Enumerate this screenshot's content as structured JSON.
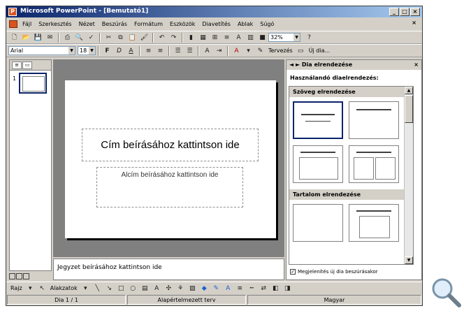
{
  "window": {
    "title": "Microsoft PowerPoint - [Bemutató1]",
    "min": "_",
    "max": "□",
    "close": "×"
  },
  "menu": [
    "Fájl",
    "Szerkesztés",
    "Nézet",
    "Beszúrás",
    "Formátum",
    "Eszközök",
    "Diavetítés",
    "Ablak",
    "Súgó"
  ],
  "menu_close": "×",
  "toolbar": {
    "zoom": "32%",
    "help": "?",
    "font": "Arial",
    "size": "18",
    "design_label": "Tervezés",
    "new_slide_label": "Új dia..."
  },
  "outline": {
    "slide_number": "1"
  },
  "slide": {
    "title_placeholder": "Cím beírásához kattintson ide",
    "subtitle_placeholder": "Alcím beírásához kattintson ide"
  },
  "notes_placeholder": "Jegyzet beírásához kattintson ide",
  "taskpane": {
    "title": "Dia elrendezése",
    "close": "×",
    "subtitle": "Használandó diaelrendezés:",
    "section_text": "Szöveg elrendezése",
    "section_content": "Tartalom elrendezése",
    "checkbox_label": "Megjelenítés új dia beszúrásakor",
    "checkbox_checked": true
  },
  "drawbar": {
    "draw_label": "Rajz",
    "autoshapes_label": "Alakzatok"
  },
  "status": {
    "slide": "Dia 1 / 1",
    "design": "Alapértelmezett terv",
    "language": "Magyar"
  }
}
